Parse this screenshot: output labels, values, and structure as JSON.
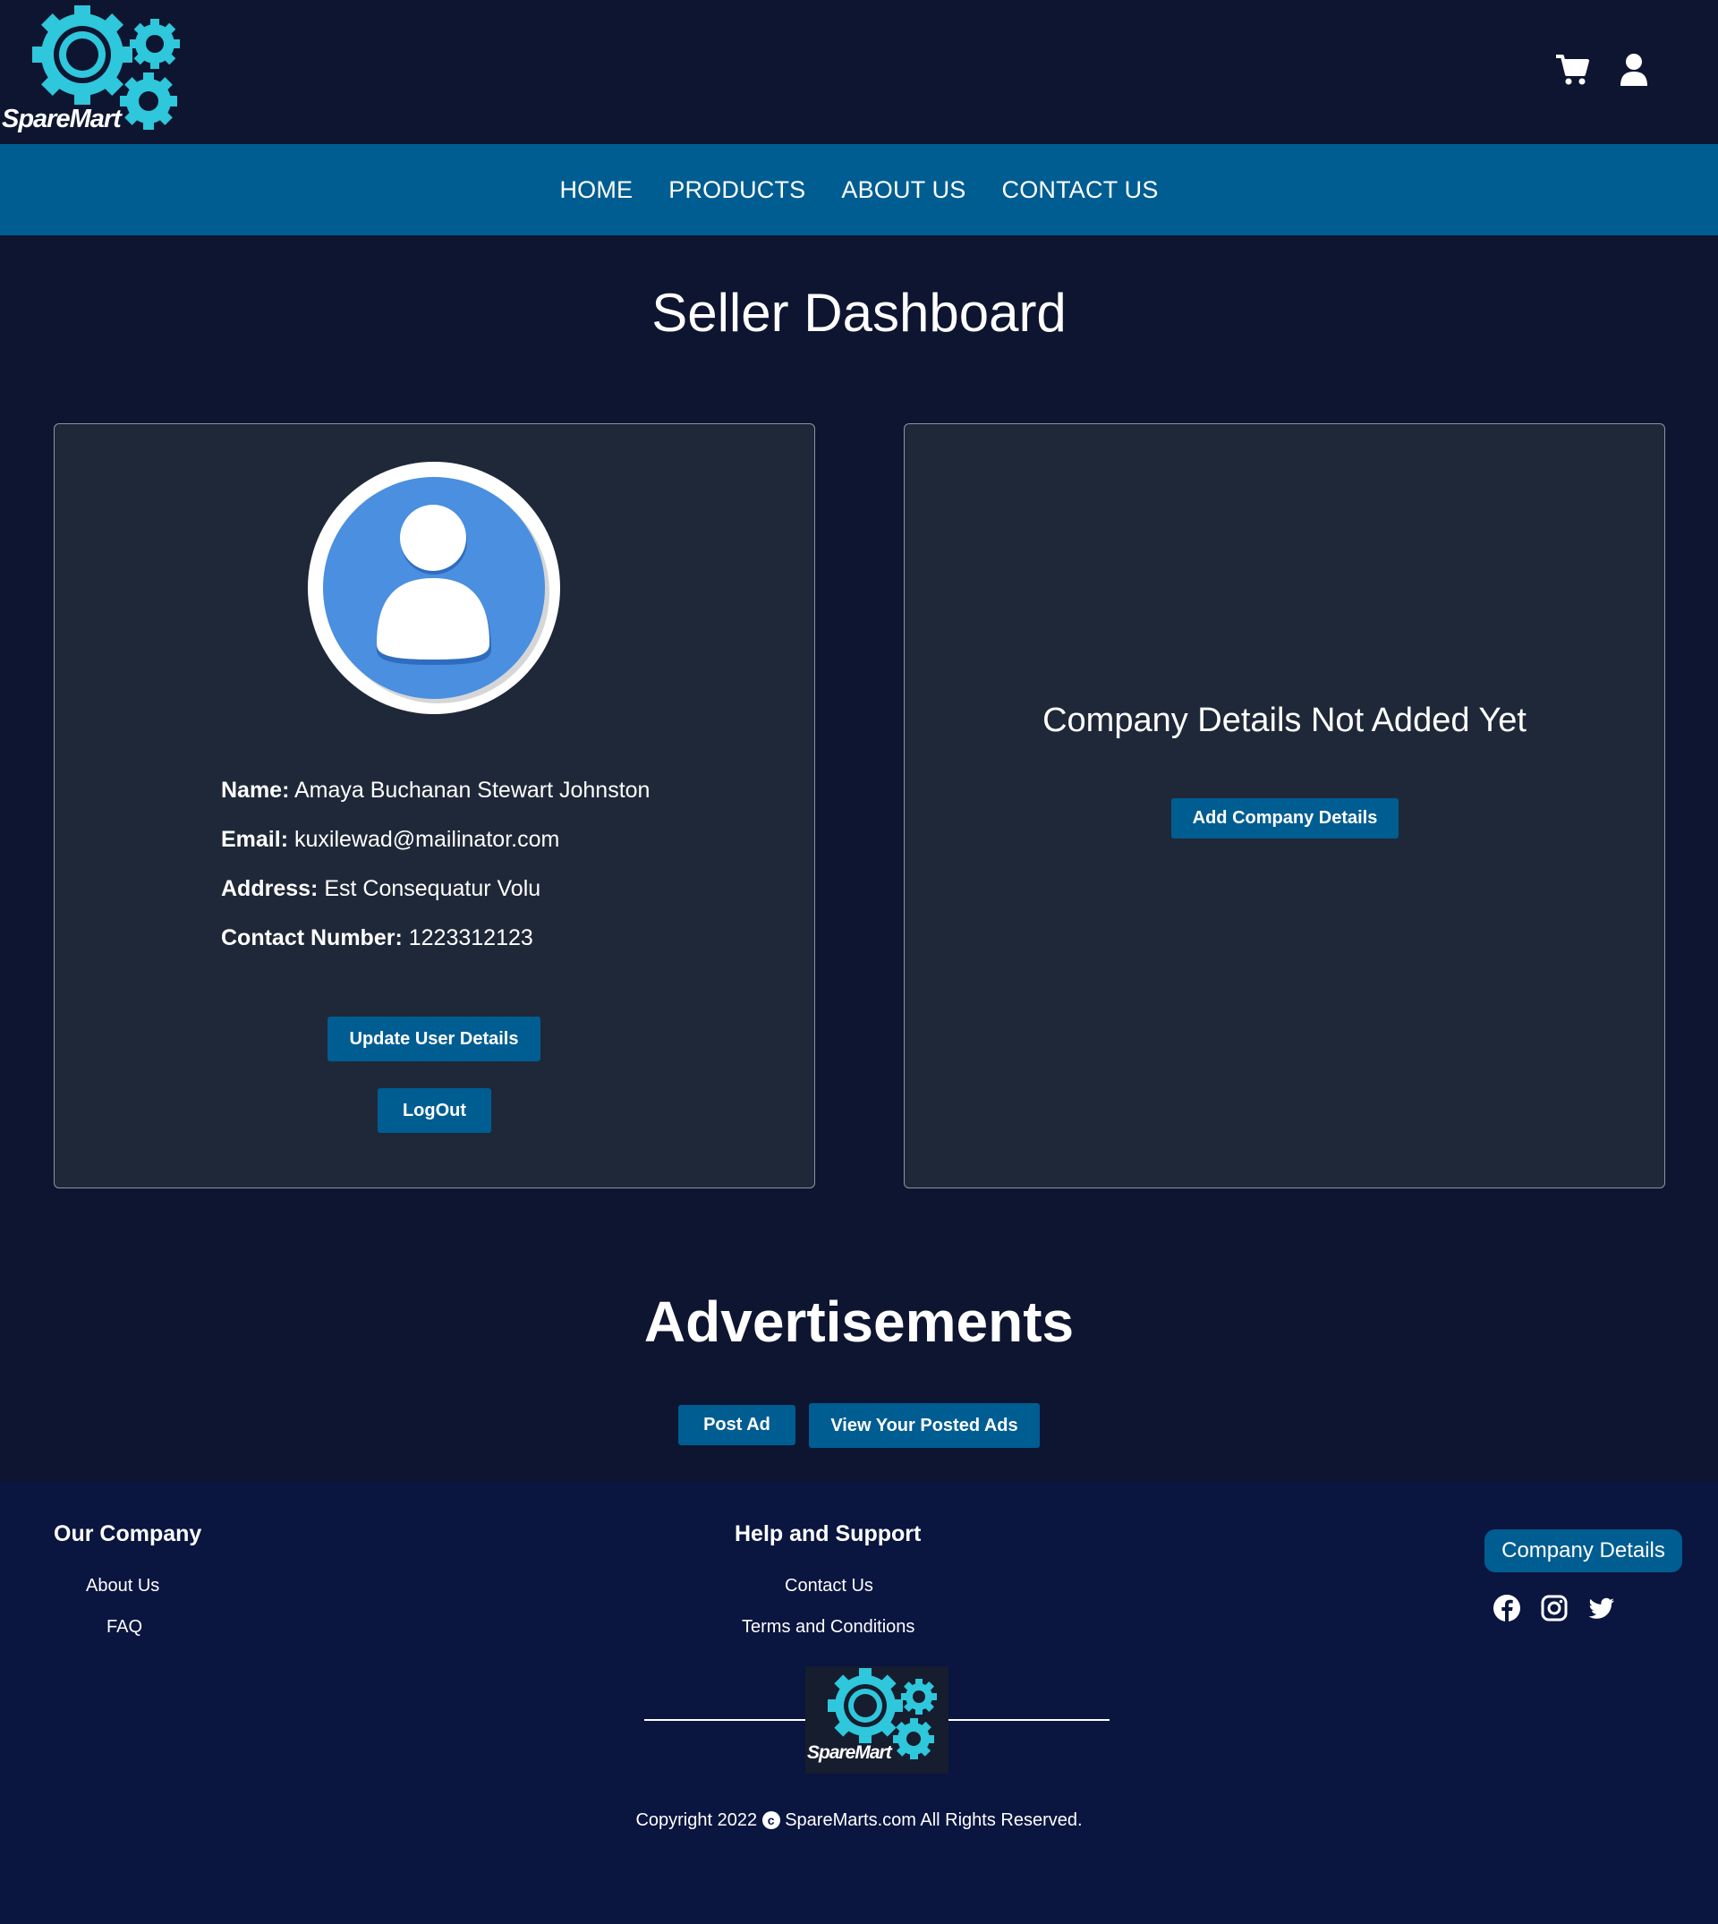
{
  "brand": {
    "name": "SpareMart"
  },
  "header": {
    "cart_icon": "cart-icon",
    "user_icon": "user-icon"
  },
  "nav": {
    "items": [
      {
        "label": "HOME"
      },
      {
        "label": "PRODUCTS"
      },
      {
        "label": "ABOUT US"
      },
      {
        "label": "CONTACT US"
      }
    ]
  },
  "page": {
    "title": "Seller Dashboard"
  },
  "user_card": {
    "name_label": "Name:",
    "name_value": "Amaya Buchanan Stewart Johnston",
    "email_label": "Email:",
    "email_value": "kuxilewad@mailinator.com",
    "address_label": "Address:",
    "address_value": "Est Consequatur Volu",
    "contact_label": "Contact Number:",
    "contact_value": "1223312123",
    "update_button": "Update User Details",
    "logout_button": "LogOut"
  },
  "company_card": {
    "message": "Company Details Not Added Yet",
    "add_button": "Add Company Details"
  },
  "ads": {
    "title": "Advertisements",
    "post_button": "Post Ad",
    "view_button": "View Your Posted Ads"
  },
  "footer": {
    "our_company": {
      "heading": "Our Company",
      "links": [
        "About Us",
        "FAQ"
      ]
    },
    "help": {
      "heading": "Help and Support",
      "links": [
        "Contact Us",
        "Terms and Conditions"
      ]
    },
    "company_details_button": "Company Details",
    "social": [
      "facebook-icon",
      "instagram-icon",
      "twitter-icon"
    ],
    "copyright_prefix": "Copyright 2022",
    "copyright_symbol": "c",
    "copyright_suffix": "SpareMarts.com All Rights Reserved."
  },
  "colors": {
    "background": "#0e1530",
    "nav": "#005d92",
    "card": "#1f2838",
    "footer": "#0a1540",
    "accent": "#2ec7dc",
    "avatar": "#4a8fe0"
  }
}
